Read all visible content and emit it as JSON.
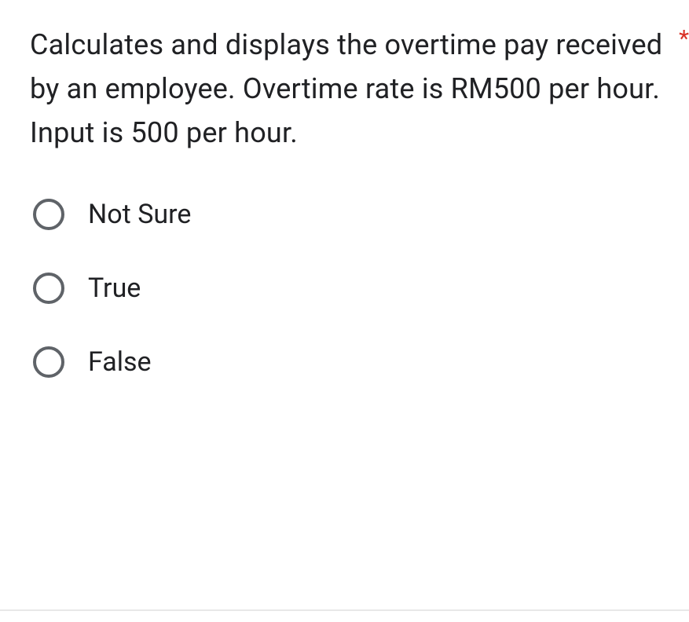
{
  "question": {
    "text": "Calculates and displays the overtime pay received by an employee. Overtime rate is RM500 per hour. Input is 500 per hour.",
    "required_marker": "*"
  },
  "options": [
    {
      "label": "Not Sure",
      "selected": false
    },
    {
      "label": "True",
      "selected": false
    },
    {
      "label": "False",
      "selected": false
    }
  ]
}
